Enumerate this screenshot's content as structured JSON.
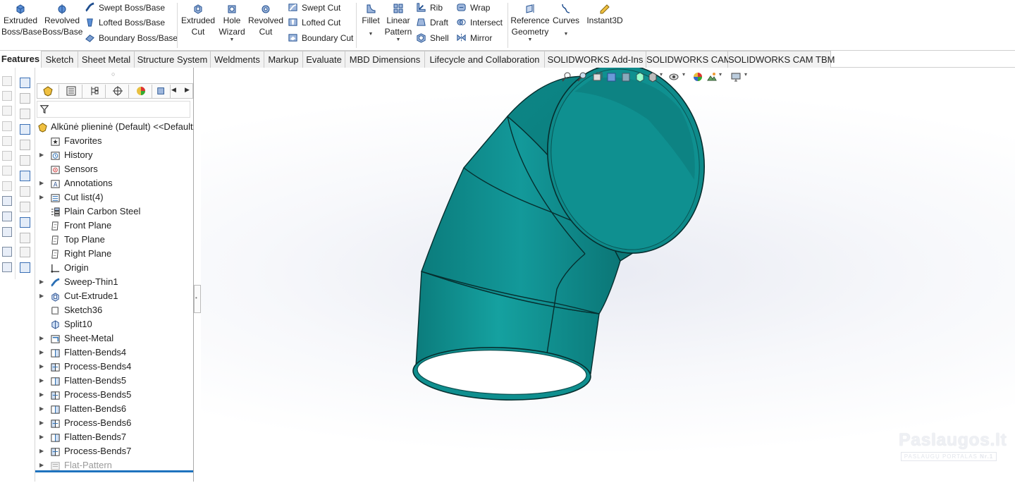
{
  "ribbon": {
    "buttons": [
      {
        "name": "extruded-boss-base",
        "line1": "Extruded",
        "line2": "Boss/Base"
      },
      {
        "name": "revolved-boss-base",
        "line1": "Revolved",
        "line2": "Boss/Base"
      },
      {
        "name": "extruded-cut",
        "line1": "Extruded",
        "line2": "Cut"
      },
      {
        "name": "hole-wizard",
        "line1": "Hole",
        "line2": "Wizard"
      },
      {
        "name": "revolved-cut",
        "line1": "Revolved",
        "line2": "Cut"
      },
      {
        "name": "fillet",
        "line1": "Fillet",
        "line2": ""
      },
      {
        "name": "linear-pattern",
        "line1": "Linear",
        "line2": "Pattern"
      },
      {
        "name": "reference-geometry",
        "line1": "Reference",
        "line2": "Geometry"
      },
      {
        "name": "curves",
        "line1": "Curves",
        "line2": ""
      },
      {
        "name": "instant3d",
        "line1": "Instant3D",
        "line2": ""
      }
    ],
    "small": {
      "swept_boss": "Swept Boss/Base",
      "lofted_boss": "Lofted Boss/Base",
      "boundary_boss": "Boundary Boss/Base",
      "swept_cut": "Swept Cut",
      "lofted_cut": "Lofted Cut",
      "boundary_cut": "Boundary Cut",
      "rib": "Rib",
      "draft": "Draft",
      "shell": "Shell",
      "wrap": "Wrap",
      "intersect": "Intersect",
      "mirror": "Mirror"
    }
  },
  "tabs": [
    "Features",
    "Sketch",
    "Sheet Metal",
    "Structure System",
    "Weldments",
    "Markup",
    "Evaluate",
    "MBD Dimensions",
    "Lifecycle and Collaboration",
    "SOLIDWORKS Add-Ins",
    "SOLIDWORKS CAM",
    "SOLIDWORKS CAM TBM"
  ],
  "active_tab": "Features",
  "tree": {
    "root": "Alkūnė plieninė (Default) <<Default:",
    "items": [
      {
        "label": "Favorites",
        "icon": "favorites-icon",
        "expand": false
      },
      {
        "label": "History",
        "icon": "history-icon",
        "expand": true
      },
      {
        "label": "Sensors",
        "icon": "sensors-icon",
        "expand": false
      },
      {
        "label": "Annotations",
        "icon": "annotations-icon",
        "expand": true
      },
      {
        "label": "Cut list(4)",
        "icon": "cut-list-icon",
        "expand": true
      },
      {
        "label": "Plain Carbon Steel",
        "icon": "material-icon",
        "expand": false
      },
      {
        "label": "Front Plane",
        "icon": "plane-icon",
        "expand": false
      },
      {
        "label": "Top Plane",
        "icon": "plane-icon",
        "expand": false
      },
      {
        "label": "Right Plane",
        "icon": "plane-icon",
        "expand": false
      },
      {
        "label": "Origin",
        "icon": "origin-icon",
        "expand": false
      },
      {
        "label": "Sweep-Thin1",
        "icon": "sweep-icon",
        "expand": true
      },
      {
        "label": "Cut-Extrude1",
        "icon": "cut-extrude-icon",
        "expand": true
      },
      {
        "label": "Sketch36",
        "icon": "sketch-icon",
        "expand": false
      },
      {
        "label": "Split10",
        "icon": "split-icon",
        "expand": false
      },
      {
        "label": "Sheet-Metal",
        "icon": "sheet-metal-icon",
        "expand": true
      },
      {
        "label": "Flatten-Bends4",
        "icon": "flatten-bends-icon",
        "expand": true
      },
      {
        "label": "Process-Bends4",
        "icon": "process-bends-icon",
        "expand": true
      },
      {
        "label": "Flatten-Bends5",
        "icon": "flatten-bends-icon",
        "expand": true
      },
      {
        "label": "Process-Bends5",
        "icon": "process-bends-icon",
        "expand": true
      },
      {
        "label": "Flatten-Bends6",
        "icon": "flatten-bends-icon",
        "expand": true
      },
      {
        "label": "Process-Bends6",
        "icon": "process-bends-icon",
        "expand": true
      },
      {
        "label": "Flatten-Bends7",
        "icon": "flatten-bends-icon",
        "expand": true
      },
      {
        "label": "Process-Bends7",
        "icon": "process-bends-icon",
        "expand": true
      },
      {
        "label": "Flat-Pattern",
        "icon": "flat-pattern-icon",
        "expand": true,
        "suppressed": true
      }
    ]
  },
  "watermark": {
    "brand": "Paslaugos.lt",
    "tagline": "PASLAUGŲ PORTALAS",
    "badge": "Nr.1"
  },
  "colors": {
    "part": "#0f8c8c",
    "part_dark": "#0a6d6e",
    "part_light": "#17a3a2",
    "accent": "#1e73be"
  }
}
